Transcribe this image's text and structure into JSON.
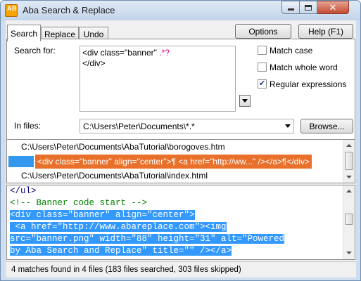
{
  "window": {
    "title": "Aba Search & Replace",
    "icon_letters": [
      "A",
      "B"
    ]
  },
  "tabs": [
    {
      "label": "Search",
      "active": true
    },
    {
      "label": "Replace",
      "active": false
    },
    {
      "label": "Undo",
      "active": false
    }
  ],
  "buttons": {
    "options": "Options",
    "help": "Help (F1)",
    "browse": "Browse..."
  },
  "search": {
    "label": "Search for:",
    "line1_prefix": "<div class=\"banner\" ",
    "line1_dot": ".*",
    "line1_suffix": "?",
    "line2": "</div>"
  },
  "checkboxes": [
    {
      "label": "Match case",
      "checked": false
    },
    {
      "label": "Match whole word",
      "checked": false
    },
    {
      "label": "Regular expressions",
      "checked": true
    }
  ],
  "files": {
    "label": "In files:",
    "value": "C:\\Users\\Peter\\Documents\\*.*"
  },
  "results": {
    "file1": "C:\\Users\\Peter\\Documents\\AbaTutorial\\borogoves.htm",
    "match": "<div class=\"banner\" align=\"center\">¶ <a href=\"http://ww...\" /></a>¶</div>",
    "file2": "C:\\Users\\Peter\\Documents\\AbaTutorial\\index.html"
  },
  "preview": {
    "line1": "</ul>",
    "line2": "<!-- Banner code start -->",
    "line3": "<div class=\"banner\" align=\"center\">",
    "line4": " <a href=\"http://www.abareplace.com\"><img",
    "line5": "src=\"banner.png\" width=\"88\" height=\"31\" alt=\"Powered",
    "line6": "by Aba Search and Replace\" title=\"\" /></a>"
  },
  "status": "4 matches found in 4 files (183 files searched, 303 files skipped)",
  "colors": {
    "match_highlight": "#e8702a",
    "selection": "#3399ff",
    "comment": "#008000"
  }
}
